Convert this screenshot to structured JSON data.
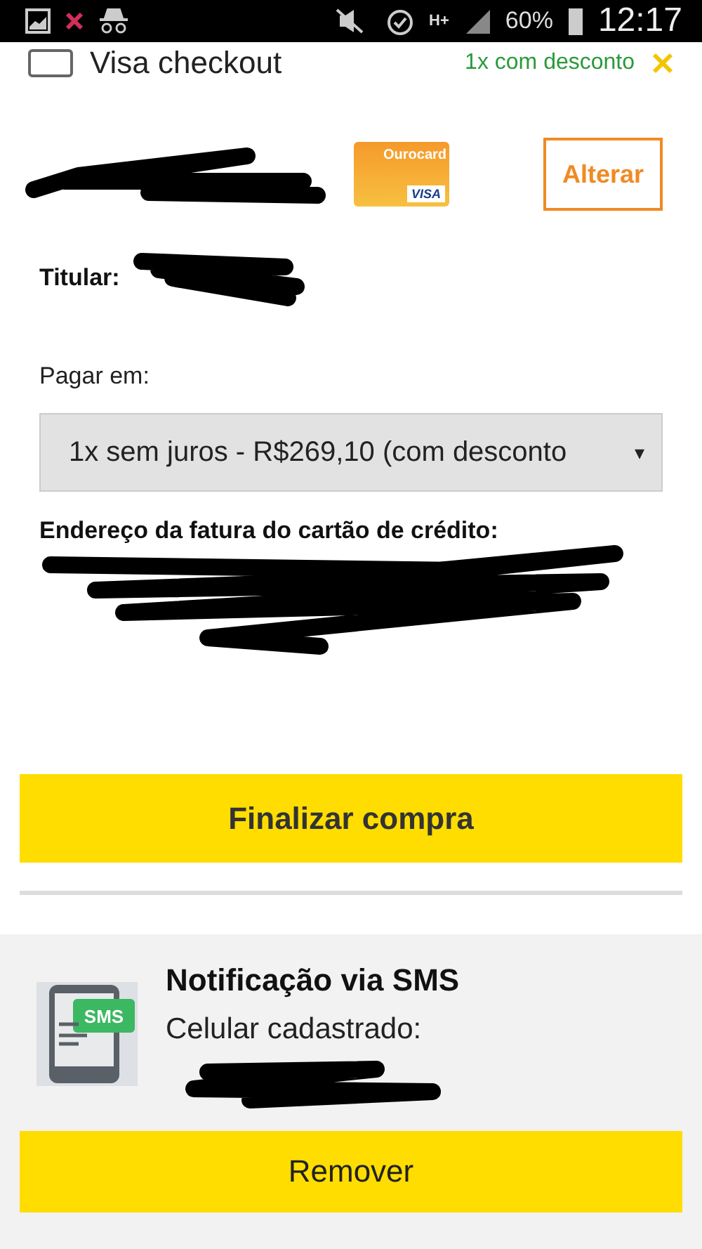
{
  "status_bar": {
    "battery": "60%",
    "time": "12:17",
    "network": "H+"
  },
  "top_option": {
    "label": "Visa checkout",
    "note": "1x com desconto",
    "checked": false
  },
  "card": {
    "brand_name": "Ourocard",
    "network": "VISA",
    "change_button": "Alterar"
  },
  "holder": {
    "label": "Titular:"
  },
  "installments": {
    "label": "Pagar em:",
    "value": "1x sem juros - R$269,10 (com desconto",
    "caret": "▾"
  },
  "billing_address": {
    "label": "Endereço da fatura do cartão de crédito:"
  },
  "finish_button": "Finalizar compra",
  "sms": {
    "title": "Notificação via SMS",
    "phone_label": "Celular cadastrado:",
    "icon_text": "SMS",
    "remove_button": "Remover"
  }
}
